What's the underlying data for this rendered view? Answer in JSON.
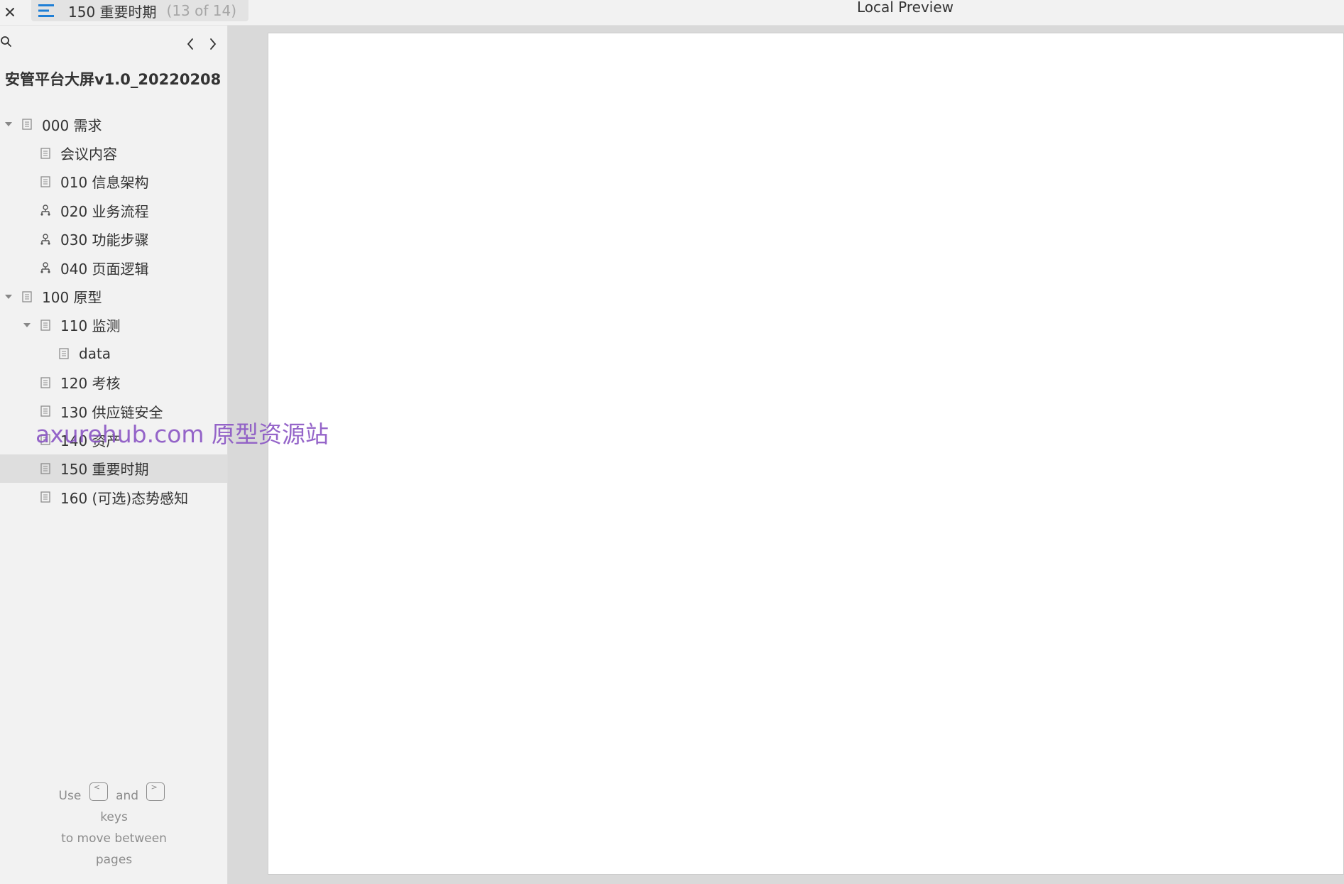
{
  "topbar": {
    "close_icon": "close-icon",
    "menu_icon": "menu-lines-icon",
    "current_page": "150 重要时期",
    "page_count": "(13 of 14)",
    "window_title": "Local Preview",
    "accent_color": "#1f7fd6"
  },
  "sidebar": {
    "search_icon": "search-icon",
    "prev_icon": "chevron-left-icon",
    "next_icon": "chevron-right-icon",
    "project_title": "安管平台大屏v1.0_20220208",
    "items": [
      {
        "label": "000 需求",
        "icon": "page-icon",
        "level": 0,
        "expanded": true
      },
      {
        "label": "会议内容",
        "icon": "page-icon",
        "level": 1
      },
      {
        "label": "010 信息架构",
        "icon": "page-icon",
        "level": 1
      },
      {
        "label": "020 业务流程",
        "icon": "flow-icon",
        "level": 1
      },
      {
        "label": "030 功能步骤",
        "icon": "flow-icon",
        "level": 1
      },
      {
        "label": "040 页面逻辑",
        "icon": "flow-icon",
        "level": 1
      },
      {
        "label": "100 原型",
        "icon": "page-icon",
        "level": 0,
        "expanded": true
      },
      {
        "label": "110 监测",
        "icon": "page-icon",
        "level": 1,
        "expanded": true
      },
      {
        "label": "data",
        "icon": "page-icon",
        "level": 2
      },
      {
        "label": "120 考核",
        "icon": "page-icon",
        "level": 1
      },
      {
        "label": "130 供应链安全",
        "icon": "page-icon",
        "level": 1
      },
      {
        "label": "140 资产",
        "icon": "page-icon",
        "level": 1
      },
      {
        "label": "150 重要时期",
        "icon": "page-icon",
        "level": 1,
        "selected": true
      },
      {
        "label": "160 (可选)态势感知",
        "icon": "page-icon",
        "level": 1
      }
    ],
    "hint": {
      "use": "Use",
      "key_prev": "<",
      "and": "and",
      "key_next": ">",
      "keys": "keys",
      "line2": "to move between",
      "line3": "pages"
    }
  },
  "watermark": "axurehub.com 原型资源站"
}
